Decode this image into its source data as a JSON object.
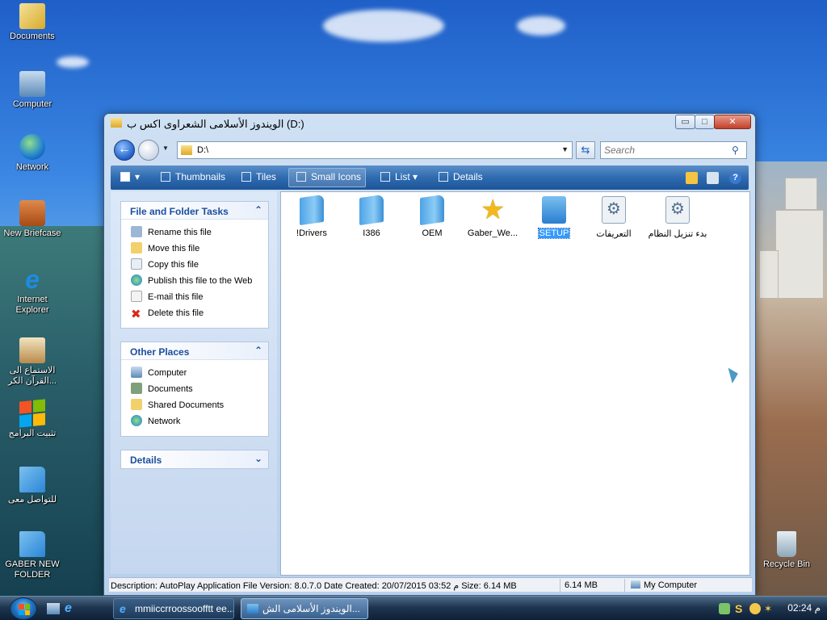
{
  "desktop": {
    "icons": [
      {
        "label": "Documents"
      },
      {
        "label": "Computer"
      },
      {
        "label": "Network"
      },
      {
        "label": "New Briefcase"
      },
      {
        "label": "Internet Explorer"
      },
      {
        "label": "الاستماع الى القرآن الكر..."
      },
      {
        "label": "تثبيت البرامج"
      },
      {
        "label": "للتواصل معى"
      },
      {
        "label": "GABER NEW FOLDER"
      },
      {
        "label": "Recycle Bin"
      }
    ]
  },
  "window": {
    "title": "الويندوز الأسلامى الشعراوى اكس ب (D:)",
    "controls": {
      "minimize": "▭",
      "maximize": "□",
      "close": "✕"
    },
    "address": {
      "path": "D:\\",
      "search_placeholder": "Search"
    },
    "toolbar": {
      "views_label": "",
      "items": [
        "Thumbnails",
        "Tiles",
        "Small Icons",
        "List",
        "Details"
      ]
    },
    "left_pane": {
      "file_tasks": {
        "title": "File and Folder Tasks",
        "items": [
          "Rename this file",
          "Move this file",
          "Copy this file",
          "Publish this file to the Web",
          "E-mail this file",
          "Delete this file"
        ]
      },
      "other_places": {
        "title": "Other Places",
        "items": [
          "Computer",
          "Documents",
          "Shared Documents",
          "Network"
        ]
      },
      "details": {
        "title": "Details"
      }
    },
    "files": [
      {
        "name": "!Drivers",
        "type": "folder"
      },
      {
        "name": "I386",
        "type": "folder"
      },
      {
        "name": "OEM",
        "type": "folder"
      },
      {
        "name": "Gaber_We...",
        "type": "shortcut"
      },
      {
        "name": "SETUP",
        "type": "app",
        "selected": true
      },
      {
        "name": "التعريفات",
        "type": "gear"
      },
      {
        "name": "بدء تنزيل النظام",
        "type": "gear"
      }
    ],
    "status": {
      "description": "Description: AutoPlay Application File Version: 8.0.7.0 Date Created: 20/07/2015 03:52 م Size: 6.14 MB",
      "size": "6.14 MB",
      "location": "My Computer"
    }
  },
  "taskbar": {
    "buttons": [
      {
        "label": "mmiiccrroossoofftt ee...",
        "active": false
      },
      {
        "label": "الويندوز الأسلامى الش...",
        "active": true
      }
    ],
    "clock": "م 02:24"
  },
  "colors": {
    "accent": "#2f6bb0",
    "panel_title": "#1b4ea0",
    "selection": "#3399ff"
  }
}
